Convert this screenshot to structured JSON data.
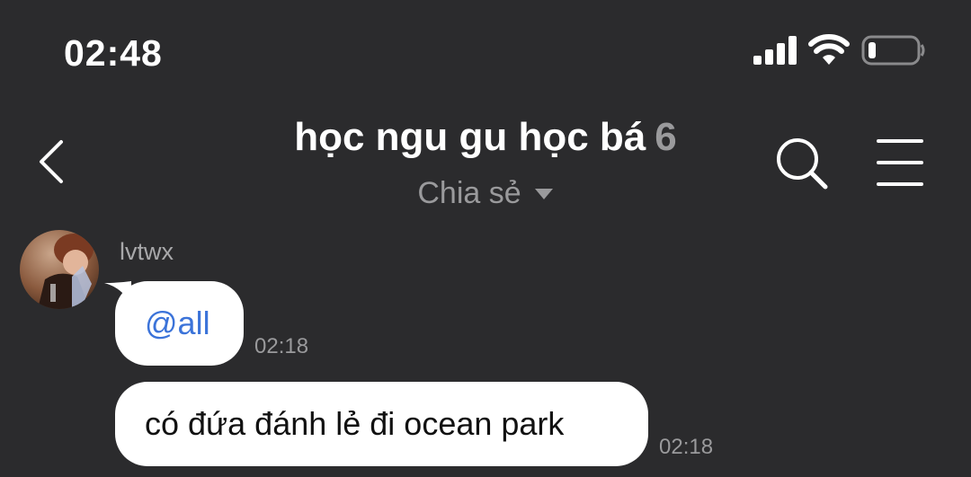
{
  "status_bar": {
    "time": "02:48"
  },
  "header": {
    "title": "học ngu gu học bá",
    "member_count": "6",
    "subtitle": "Chia sẻ"
  },
  "messages": [
    {
      "sender": "lvtwx",
      "text": "@all",
      "time": "02:18",
      "mention": true
    },
    {
      "text": "có đứa đánh lẻ đi ocean park",
      "time": "02:18"
    }
  ],
  "colors": {
    "background": "#2b2b2d",
    "bubble": "#ffffff",
    "mention": "#3b73d9",
    "muted_text": "#9a9a9c"
  },
  "icons": [
    "signal-icon",
    "wifi-icon",
    "battery-icon",
    "back-arrow-icon",
    "caret-down-icon",
    "search-icon",
    "menu-icon"
  ]
}
